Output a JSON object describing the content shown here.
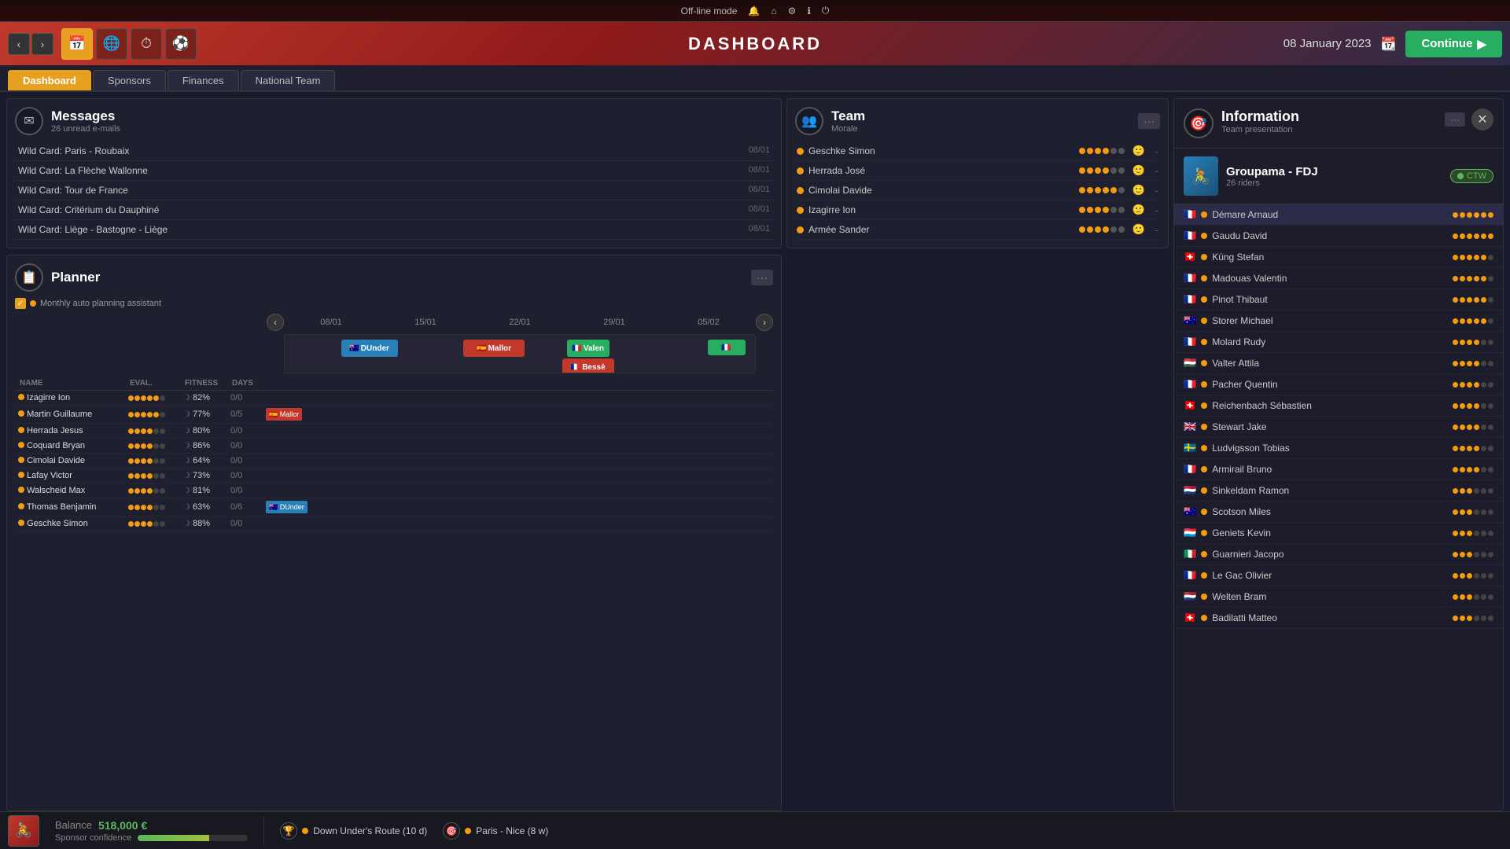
{
  "topbar": {
    "mode": "Off-line mode",
    "icons": [
      "bell",
      "home",
      "gear",
      "info",
      "power"
    ]
  },
  "navbar": {
    "title": "DASHBOARD",
    "date": "08 January 2023",
    "continue_label": "Continue",
    "nav_icons": [
      "back",
      "forward",
      "calendar",
      "globe",
      "clock",
      "soccer"
    ]
  },
  "subtabs": [
    {
      "id": "dashboard",
      "label": "Dashboard",
      "active": true
    },
    {
      "id": "sponsors",
      "label": "Sponsors"
    },
    {
      "id": "finances",
      "label": "Finances"
    },
    {
      "id": "national-team",
      "label": "National Team"
    }
  ],
  "messages": {
    "title": "Messages",
    "subtitle": "26 unread e-mails",
    "items": [
      {
        "text": "Wild Card: Paris - Roubaix",
        "date": "08/01"
      },
      {
        "text": "Wild Card: La Flèche Wallonne",
        "date": "08/01"
      },
      {
        "text": "Wild Card: Tour de France",
        "date": "08/01"
      },
      {
        "text": "Wild Card: Critérium du Dauphiné",
        "date": "08/01"
      },
      {
        "text": "Wild Card: Liège - Bastogne - Liège",
        "date": "08/01"
      }
    ]
  },
  "team_morale": {
    "title": "Team",
    "subtitle": "Morale",
    "riders": [
      {
        "name": "Geschke Simon",
        "morale": 4,
        "max": 6
      },
      {
        "name": "Herrada José",
        "morale": 4,
        "max": 6
      },
      {
        "name": "Cimolai Davide",
        "morale": 5,
        "max": 6
      },
      {
        "name": "Izagirre Ion",
        "morale": 4,
        "max": 6
      },
      {
        "name": "Armée Sander",
        "morale": 4,
        "max": 6
      }
    ]
  },
  "planner": {
    "title": "Planner",
    "auto_planning": "Monthly auto planning assistant",
    "dates": [
      "08/01",
      "15/01",
      "22/01",
      "29/01",
      "05/02"
    ],
    "columns": {
      "name": "NAME",
      "eval": "EVAL.",
      "fitness": "FITNESS",
      "days": "DAYS"
    },
    "riders": [
      {
        "name": "Izagirre Ion",
        "eval": 5,
        "fitness": 82,
        "days": "0/0",
        "race": null
      },
      {
        "name": "Martin Guillaume",
        "eval": 5,
        "fitness": 77,
        "days": "0/5",
        "race": "mallor"
      },
      {
        "name": "Herrada Jesus",
        "eval": 4,
        "fitness": 80,
        "days": "0/0",
        "race": null
      },
      {
        "name": "Coquard Bryan",
        "eval": 4,
        "fitness": 86,
        "days": "0/0",
        "race": null
      },
      {
        "name": "Cimolai Davide",
        "eval": 4,
        "fitness": 64,
        "days": "0/0",
        "race": null
      },
      {
        "name": "Lafay Victor",
        "eval": 4,
        "fitness": 73,
        "days": "0/0",
        "race": null
      },
      {
        "name": "Walscheid Max",
        "eval": 4,
        "fitness": 81,
        "days": "0/0",
        "race": null
      },
      {
        "name": "Thomas Benjamin",
        "eval": 4,
        "fitness": 63,
        "days": "0/6",
        "race": "dunder"
      },
      {
        "name": "Geschke Simon",
        "eval": 4,
        "fitness": 88,
        "days": "0/0",
        "race": null
      }
    ],
    "race_blocks": [
      {
        "name": "DUnder",
        "type": "aus",
        "left_pct": 15,
        "width_pct": 12
      },
      {
        "name": "Mallor",
        "type": "esp",
        "left_pct": 36,
        "width_pct": 13
      },
      {
        "name": "Valen",
        "type": "fr",
        "left_pct": 59,
        "width_pct": 8
      },
      {
        "name": "Bessè",
        "type": "fr",
        "left_pct": 59,
        "width_pct": 11
      }
    ]
  },
  "info_panel": {
    "title": "Information",
    "subtitle": "Team presentation",
    "team_name": "Groupama - FDJ",
    "riders_count": "26 riders",
    "riders": [
      {
        "name": "Démare Arnaud",
        "flag": "🇫🇷",
        "rating": 6,
        "status": "orange"
      },
      {
        "name": "Gaudu David",
        "flag": "🇫🇷",
        "rating": 6,
        "status": "orange"
      },
      {
        "name": "Küng Stefan",
        "flag": "🇨🇭",
        "rating": 5,
        "status": "orange"
      },
      {
        "name": "Madouas Valentin",
        "flag": "🇫🇷",
        "rating": 5,
        "status": "orange"
      },
      {
        "name": "Pinot Thibaut",
        "flag": "🇫🇷",
        "rating": 5,
        "status": "orange"
      },
      {
        "name": "Storer Michael",
        "flag": "🇦🇺",
        "rating": 5,
        "status": "orange"
      },
      {
        "name": "Molard Rudy",
        "flag": "🇫🇷",
        "rating": 4,
        "status": "orange"
      },
      {
        "name": "Valter Attila",
        "flag": "🇭🇺",
        "rating": 4,
        "status": "orange"
      },
      {
        "name": "Pacher Quentin",
        "flag": "🇫🇷",
        "rating": 4,
        "status": "orange"
      },
      {
        "name": "Reichenbach Sébastien",
        "flag": "🇨🇭",
        "rating": 4,
        "status": "orange"
      },
      {
        "name": "Stewart Jake",
        "flag": "🇬🇧",
        "rating": 4,
        "status": "orange"
      },
      {
        "name": "Ludvigsson Tobias",
        "flag": "🇸🇪",
        "rating": 4,
        "status": "orange"
      },
      {
        "name": "Armirail Bruno",
        "flag": "🇫🇷",
        "rating": 4,
        "status": "orange"
      },
      {
        "name": "Sinkeldam Ramon",
        "flag": "🇳🇱",
        "rating": 3,
        "status": "orange"
      },
      {
        "name": "Scotson Miles",
        "flag": "🇦🇺",
        "rating": 3,
        "status": "orange"
      },
      {
        "name": "Geniets Kevin",
        "flag": "🇱🇺",
        "rating": 3,
        "status": "orange"
      },
      {
        "name": "Guarnieri Jacopo",
        "flag": "🇮🇹",
        "rating": 3,
        "status": "orange"
      },
      {
        "name": "Le Gac Olivier",
        "flag": "🇫🇷",
        "rating": 3,
        "status": "orange"
      },
      {
        "name": "Welten Bram",
        "flag": "🇳🇱",
        "rating": 3,
        "status": "orange"
      },
      {
        "name": "Badilatti Matteo",
        "flag": "🇨🇭",
        "rating": 3,
        "status": "orange"
      }
    ]
  },
  "bottom": {
    "balance_label": "Balance",
    "balance_value": "518,000 €",
    "sponsor_label": "Sponsor confidence",
    "events": [
      {
        "name": "Down Under's Route (10 d)",
        "icon": "trophy"
      },
      {
        "name": "Paris - Nice (8 w)",
        "icon": "stage"
      }
    ]
  }
}
